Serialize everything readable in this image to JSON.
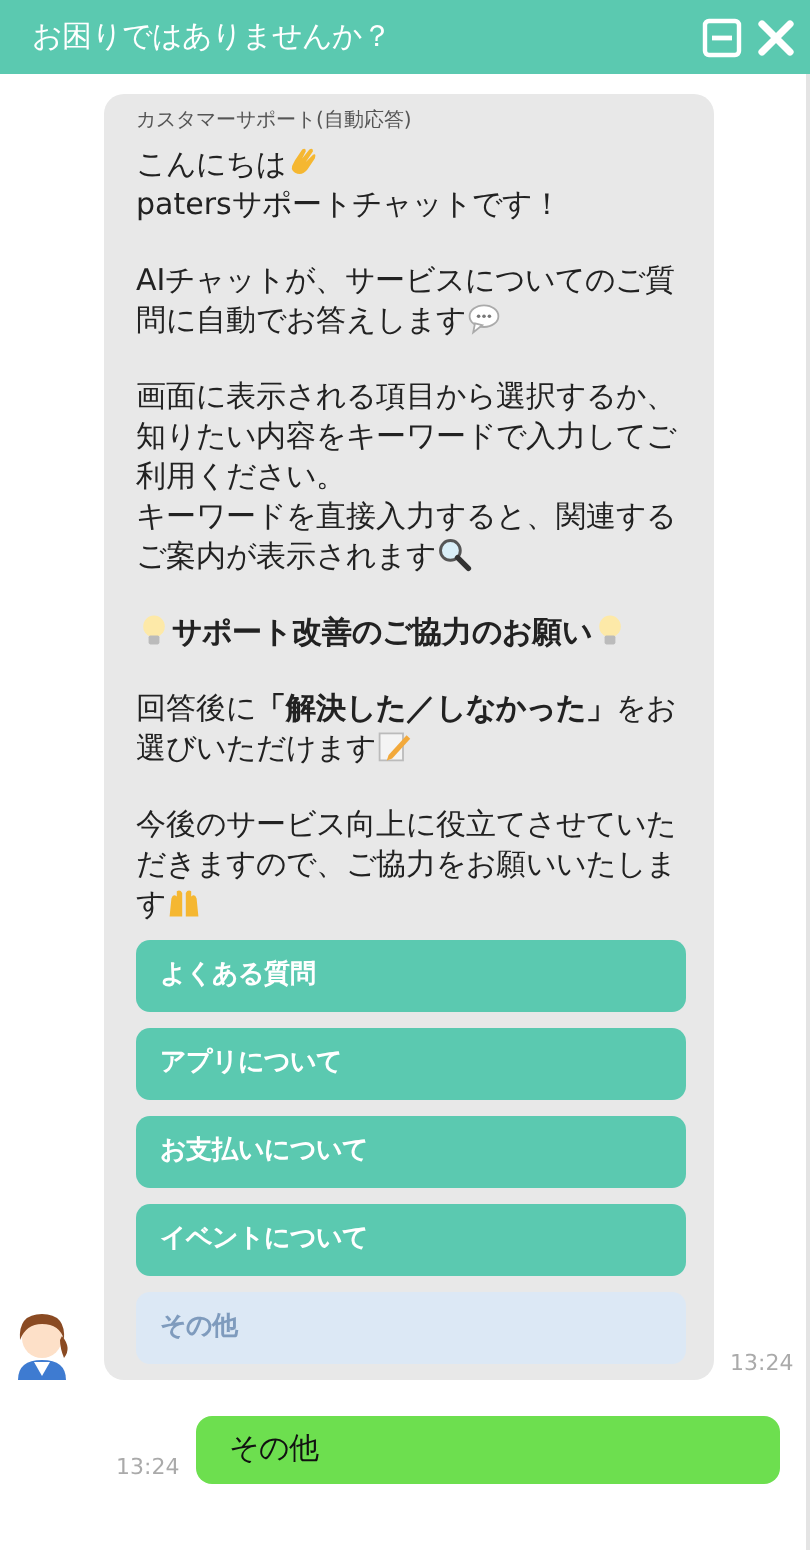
{
  "header": {
    "title": "お困りではありませんか？"
  },
  "bot_message": {
    "sender": "カスタマーサポート(自動応答)",
    "time": "13:24",
    "paragraphs": [
      {
        "lines": [
          [
            {
              "kind": "text",
              "text": "こんにちは"
            },
            {
              "kind": "icon"
            }
          ],
          [
            {
              "kind": "text",
              "text": "patersサポートチャットです！"
            }
          ]
        ]
      },
      {
        "lines": [
          [
            {
              "kind": "text",
              "text": "AIチャットが、サービスについてのご質問に自動でお答えします"
            },
            {
              "kind": "icon"
            }
          ]
        ]
      },
      {
        "lines": [
          [
            {
              "kind": "text",
              "text": "画面に表示される項目から選択するか、知りたい内容をキーワードで入力してご利用ください。"
            }
          ],
          [
            {
              "kind": "text",
              "text": "キーワードを直接入力すると、関連するご案内が表示されます"
            },
            {
              "kind": "icon"
            }
          ]
        ]
      },
      {
        "bold": true,
        "lines": [
          [
            {
              "kind": "icon"
            },
            {
              "kind": "text",
              "text": "サポート改善のご協力のお願い"
            },
            {
              "kind": "icon"
            }
          ]
        ]
      },
      {
        "lines": [
          [
            {
              "kind": "text",
              "text": "回答後に**「解決した／しなかった」**をお選びいただけます"
            },
            {
              "kind": "icon"
            }
          ]
        ]
      },
      {
        "lines": [
          [
            {
              "kind": "text",
              "text": "今後のサービス向上に役立てさせていただきますので、ご協力をお願いいたします"
            },
            {
              "kind": "icon"
            }
          ]
        ]
      }
    ],
    "options": [
      {
        "label": "よくある質問",
        "disabled": false
      },
      {
        "label": "アプリについて",
        "disabled": false
      },
      {
        "label": "お支払いについて",
        "disabled": false
      },
      {
        "label": "イベントについて",
        "disabled": false
      },
      {
        "label": "その他",
        "disabled": true
      }
    ]
  },
  "user_message": {
    "text": "その他",
    "time": "13:24"
  }
}
